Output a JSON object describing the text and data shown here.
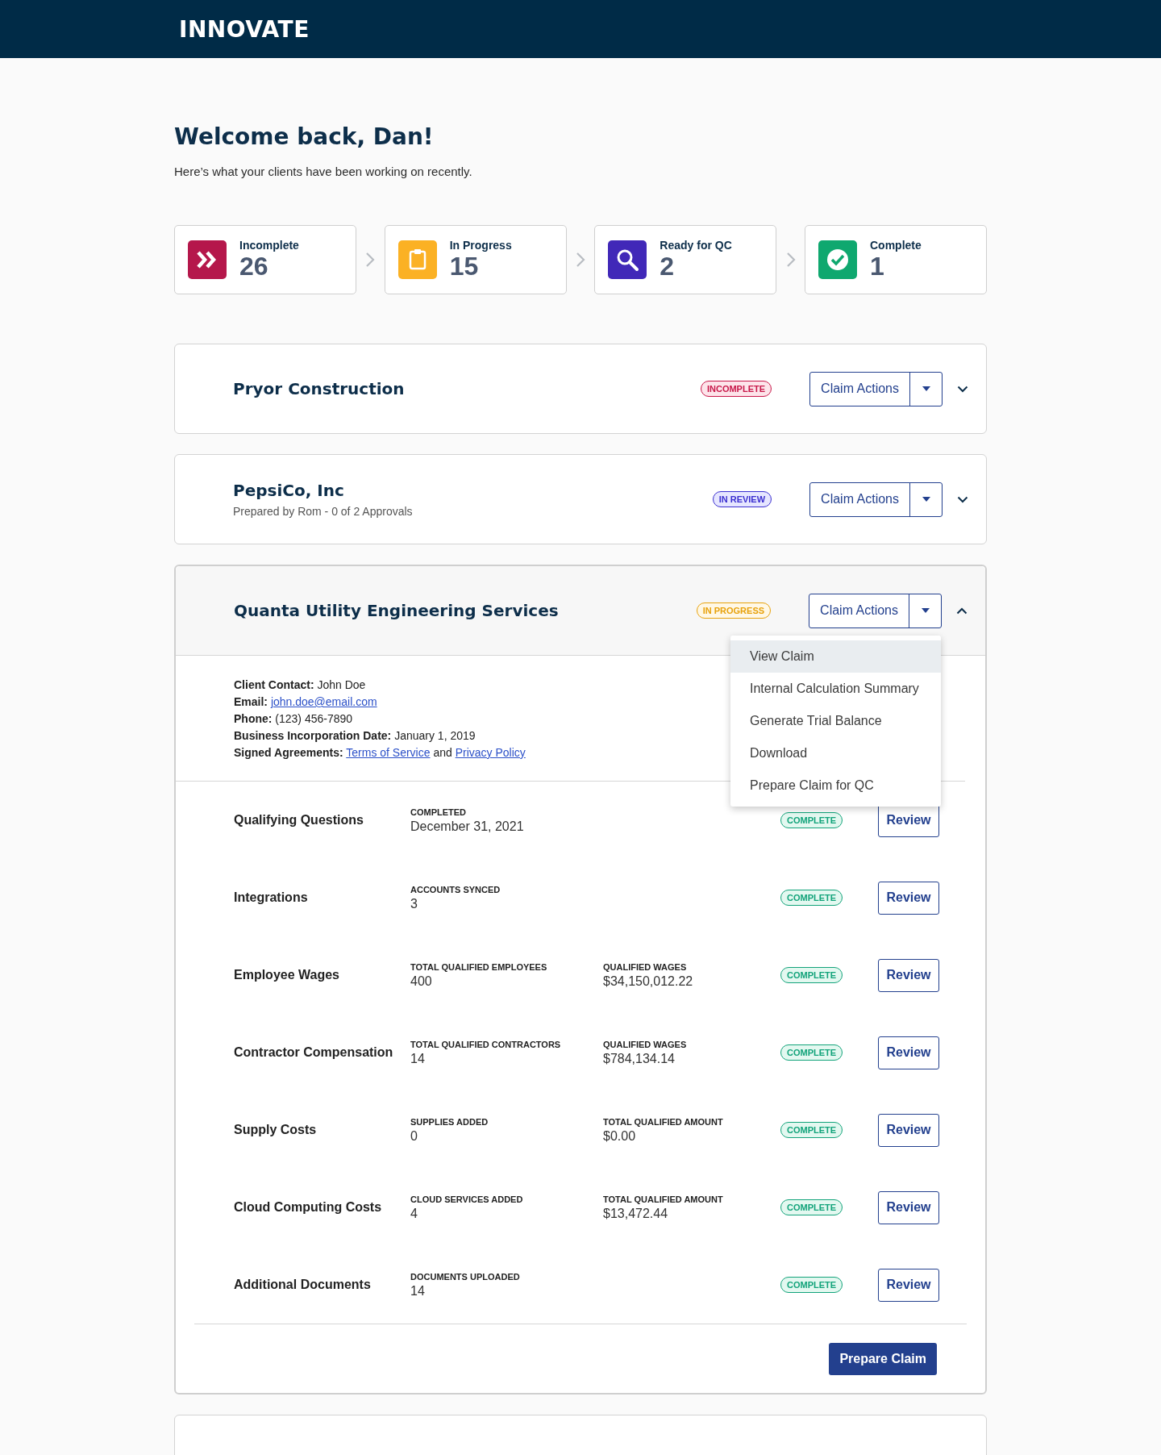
{
  "header": {
    "logo": "INNOVATE"
  },
  "greeting": {
    "title": "Welcome back, Dan!",
    "subtitle": "Here’s what your clients have been working on recently."
  },
  "stats": [
    {
      "label": "Incomplete",
      "count": "26",
      "kind": "incomplete"
    },
    {
      "label": "In Progress",
      "count": "15",
      "kind": "progress"
    },
    {
      "label": "Ready for QC",
      "count": "2",
      "kind": "qc"
    },
    {
      "label": "Complete",
      "count": "1",
      "kind": "complete"
    }
  ],
  "claims": [
    {
      "name": "Pryor Construction",
      "status": {
        "label": "INCOMPLETE",
        "kind": "incomplete"
      },
      "actions_label": "Claim Actions",
      "expanded": false
    },
    {
      "name": "PepsiCo, Inc",
      "subtitle": "Prepared by Rom - 0 of 2 Approvals",
      "status": {
        "label": "IN REVIEW",
        "kind": "review"
      },
      "actions_label": "Claim Actions",
      "expanded": false
    },
    {
      "name": "Quanta Utility Engineering Services",
      "status": {
        "label": "IN PROGRESS",
        "kind": "progress"
      },
      "actions_label": "Claim Actions",
      "expanded": true,
      "menu": [
        {
          "label": "View Claim",
          "selected": true
        },
        {
          "label": "Internal Calculation Summary",
          "selected": false
        },
        {
          "label": "Generate Trial Balance",
          "selected": false
        },
        {
          "label": "Download",
          "selected": false
        },
        {
          "label": "Prepare Claim for QC",
          "selected": false
        }
      ],
      "details": [
        {
          "label": "Client Contact:",
          "value": "John Doe"
        },
        {
          "label": "Email:",
          "links": [
            "john.doe@email.com"
          ]
        },
        {
          "label": "Phone:",
          "value": "(123) 456-7890"
        },
        {
          "label": "Business Incorporation Date:",
          "value": "January 1, 2019"
        },
        {
          "label": "Signed Agreements:",
          "links": [
            "Terms of Service",
            "Privacy Policy"
          ],
          "joiner": "and"
        }
      ],
      "sections": [
        {
          "name": "Qualifying Questions",
          "fields": [
            {
              "label": "COMPLETED",
              "value": "December 31, 2021"
            }
          ],
          "status": {
            "label": "COMPLETE",
            "kind": "complete"
          },
          "action": "Review"
        },
        {
          "name": "Integrations",
          "fields": [
            {
              "label": "ACCOUNTS SYNCED",
              "value": "3"
            }
          ],
          "status": {
            "label": "COMPLETE",
            "kind": "complete"
          },
          "action": "Review"
        },
        {
          "name": "Employee Wages",
          "fields": [
            {
              "label": "TOTAL QUALIFIED EMPLOYEES",
              "value": "400"
            },
            {
              "label": "QUALIFIED WAGES",
              "value": "$34,150,012.22"
            }
          ],
          "status": {
            "label": "COMPLETE",
            "kind": "complete"
          },
          "action": "Review"
        },
        {
          "name": "Contractor Compensation",
          "fields": [
            {
              "label": "TOTAL QUALIFIED CONTRACTORS",
              "value": "14"
            },
            {
              "label": "QUALIFIED WAGES",
              "value": "$784,134.14"
            }
          ],
          "status": {
            "label": "COMPLETE",
            "kind": "complete"
          },
          "action": "Review"
        },
        {
          "name": "Supply Costs",
          "fields": [
            {
              "label": "SUPPLIES ADDED",
              "value": "0"
            },
            {
              "label": "TOTAL QUALIFIED AMOUNT",
              "value": "$0.00"
            }
          ],
          "status": {
            "label": "COMPLETE",
            "kind": "complete"
          },
          "action": "Review"
        },
        {
          "name": "Cloud Computing Costs",
          "fields": [
            {
              "label": "CLOUD SERVICES ADDED",
              "value": "4"
            },
            {
              "label": "TOTAL QUALIFIED AMOUNT",
              "value": "$13,472.44"
            }
          ],
          "status": {
            "label": "COMPLETE",
            "kind": "complete"
          },
          "action": "Review"
        },
        {
          "name": "Additional Documents",
          "fields": [
            {
              "label": "DOCUMENTS UPLOADED",
              "value": "14"
            }
          ],
          "status": {
            "label": "COMPLETE",
            "kind": "complete"
          },
          "action": "Review"
        }
      ],
      "submit": "Prepare Claim"
    }
  ]
}
